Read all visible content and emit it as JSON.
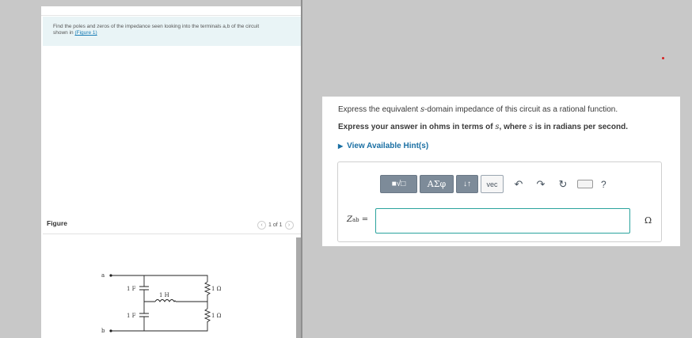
{
  "problem": {
    "text_line1": "Find the poles and zeros of the impedance seen looking into the terminals a,b of the circuit",
    "text_line2": "shown in ",
    "figure_link": "(Figure 1)"
  },
  "figure": {
    "label": "Figure",
    "page_indicator": "1 of 1",
    "prev_icon": "chevron-left-icon",
    "next_icon": "chevron-right-icon"
  },
  "circuit": {
    "terminal_a": "a",
    "terminal_b": "b",
    "capacitor_top": "1 F",
    "capacitor_bottom": "1 F",
    "inductor": "1 H",
    "resistor_top": "1 Ω",
    "resistor_bottom": "1 Ω"
  },
  "question": {
    "instruction_pre": "Express the equivalent ",
    "instruction_var": "s",
    "instruction_post": "-domain impedance of this circuit as a rational function.",
    "bold_pre": "Express your answer in ohms in terms of ",
    "bold_var1": "s",
    "bold_mid": ", where ",
    "bold_var2": "s",
    "bold_post": " is in radians per second.",
    "hints_label": "View Available Hint(s)"
  },
  "toolbar": {
    "templates_label": "■√□",
    "greek_label": "ΑΣφ",
    "arrows_label": "↓↑",
    "vec_label": "vec",
    "undo_icon": "undo-icon",
    "redo_icon": "redo-icon",
    "reset_icon": "reset-icon",
    "keyboard_icon": "keyboard-icon",
    "help_label": "?"
  },
  "answer": {
    "label_main": "Z",
    "label_sub": "ab",
    "label_eq": " =",
    "value": "",
    "unit": "Ω"
  },
  "colors": {
    "accent_link": "#1a6fa3",
    "input_border": "#2aa39d",
    "toolbar_button": "#7d8b99",
    "problem_bg": "#e9f4f6"
  }
}
